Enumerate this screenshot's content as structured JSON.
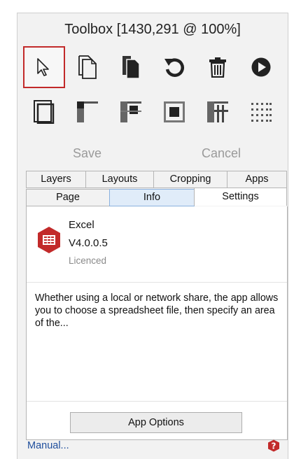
{
  "window": {
    "title": "Toolbox [1430,291 @ 100%]"
  },
  "toolbar": {
    "row1": [
      {
        "icon": "pointer-icon",
        "selected": true
      },
      {
        "icon": "new-page-icon"
      },
      {
        "icon": "copy-page-icon"
      },
      {
        "icon": "undo-icon"
      },
      {
        "icon": "delete-icon"
      },
      {
        "icon": "play-icon"
      }
    ],
    "row2": [
      {
        "icon": "page-frame-icon"
      },
      {
        "icon": "layout-top-left-icon"
      },
      {
        "icon": "layout-split-icon"
      },
      {
        "icon": "layout-center-icon"
      },
      {
        "icon": "layout-grid-icon"
      },
      {
        "icon": "layout-dots-icon"
      }
    ]
  },
  "actions": {
    "save_label": "Save",
    "cancel_label": "Cancel"
  },
  "tabs": {
    "row1": [
      "Layers",
      "Layouts",
      "Cropping",
      "Apps"
    ],
    "row2": [
      "Page",
      "Info",
      "Settings"
    ],
    "active": "Settings"
  },
  "app": {
    "name": "Excel",
    "version": "V4.0.0.5",
    "license": "Licenced",
    "icon": "excel-app-icon",
    "description": "Whether using a local or network share, the app allows you to choose a spreadsheet file, then specify an area of the...",
    "options_label": "App Options"
  },
  "footer": {
    "manual_label": "Manual...",
    "help_icon": "help-icon"
  },
  "colors": {
    "accent_red": "#c22a2a",
    "link_blue": "#1f4e9c",
    "info_tab_bg": "#e0ecf9"
  }
}
